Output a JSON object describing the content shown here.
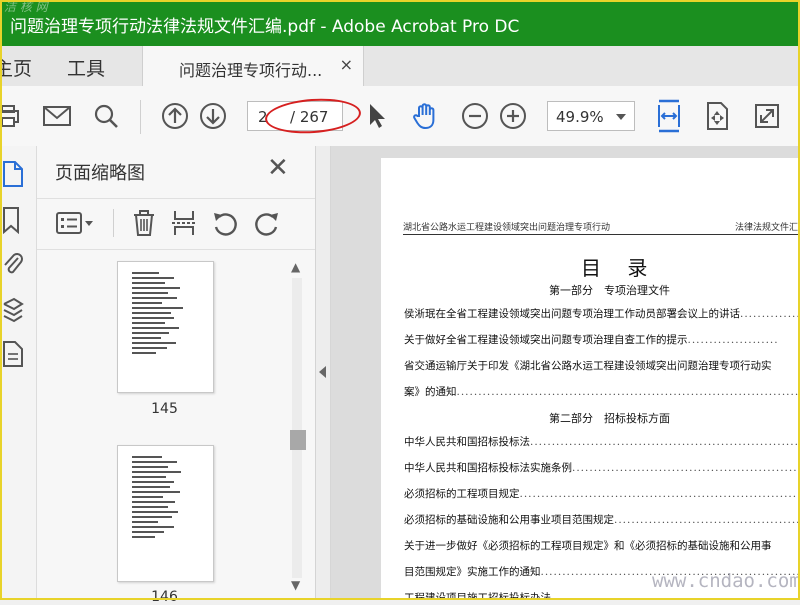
{
  "window": {
    "title": "问题治理专项行动法律法规文件汇编.pdf - Adobe Acrobat Pro DC",
    "watermark_top": "洁 核 网"
  },
  "tabs": {
    "home_label": "主页",
    "tools_label": "工具",
    "doc_tab_label": "问题治理专项行动...",
    "doc_tab_close": "×"
  },
  "toolbar": {
    "page_current": "2",
    "page_total": "/ 267",
    "zoom_value": "49.9%"
  },
  "thumbnails_panel": {
    "title": "页面缩略图",
    "close": "✕",
    "pages": [
      {
        "label": "145"
      },
      {
        "label": "146"
      }
    ]
  },
  "document": {
    "running_header_left": "湖北省公路水运工程建设领域突出问题治理专项行动",
    "running_header_right": "法律法规文件汇",
    "toc_title": "目 录",
    "sections": [
      {
        "heading": "第一部分　专项治理文件",
        "items": [
          "侯淅珉在全省工程建设领域突出问题专项治理工作动员部署会议上的讲话",
          "关于做好全省工程建设领域突出问题专项治理自查工作的提示",
          "省交通运输厅关于印发《湖北省公路水运工程建设领域突出问题治理专项行动实",
          "案》的通知"
        ]
      },
      {
        "heading": "第二部分　招标投标方面",
        "items": [
          "中华人民共和国招标投标法",
          "中华人民共和国招标投标法实施条例",
          "必须招标的工程项目规定",
          "必须招标的基础设施和公用事业项目范围规定",
          "关于进一步做好《必须招标的工程项目规定》和《必须招标的基础设施和公用事",
          "目范围规定》实施工作的通知",
          "工程建设项目施工招标投标办法"
        ]
      }
    ]
  },
  "watermark_bottom": "www.cndao.com",
  "colors": {
    "titlebar": "#1b8f1f",
    "accent_blue": "#2a6fd6",
    "annotation_red": "#d62020"
  }
}
